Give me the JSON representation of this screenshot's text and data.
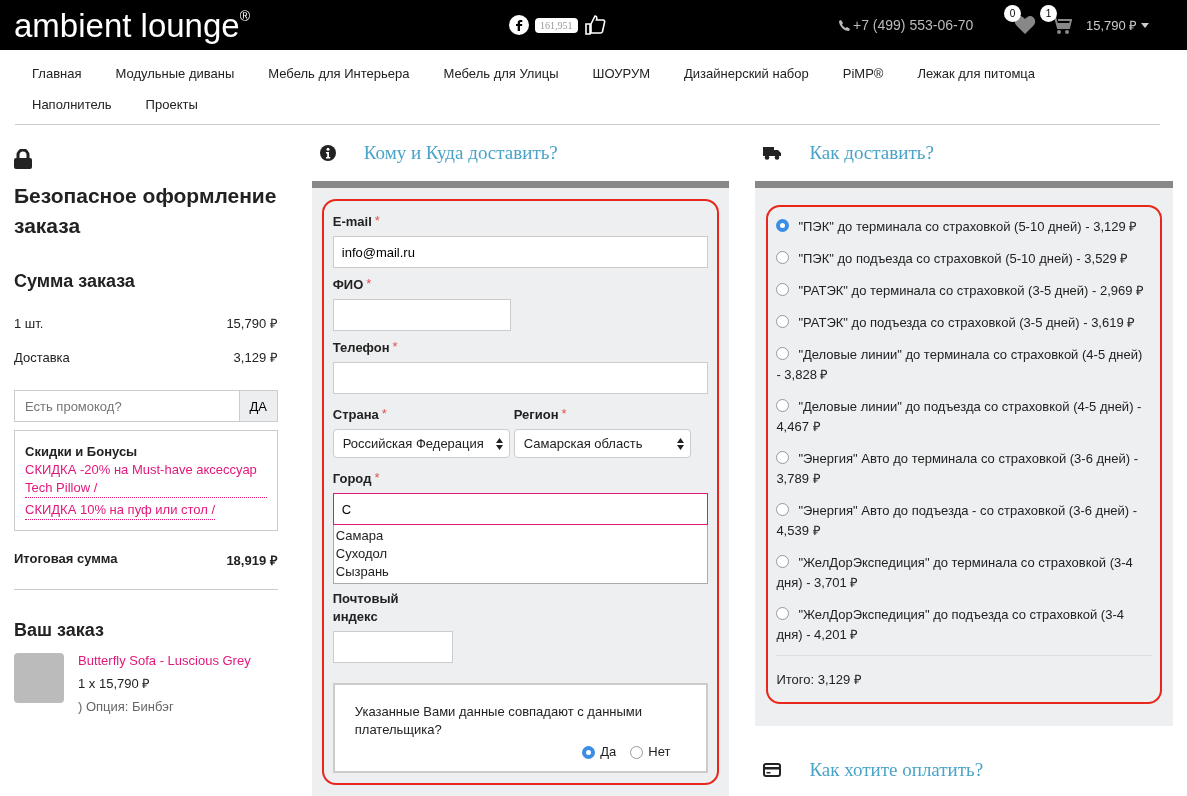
{
  "header": {
    "logo": "ambient lounge$^{®}$",
    "like_count": "161,951",
    "phone": "+7 (499) 553-06-70",
    "wishlist_count": "0",
    "cart_count": "1",
    "cart_total": "15,790 ₽"
  },
  "nav": [
    {
      "label": "Главная"
    },
    {
      "label": "Модульные диваны"
    },
    {
      "label": "Мебель для Интерьера"
    },
    {
      "label": "Мебель для Улицы"
    },
    {
      "label": "ШОУРУМ"
    },
    {
      "label": "Дизайнерский набор"
    },
    {
      "label": "PiMP®"
    },
    {
      "label": "Лежак для питомца"
    },
    {
      "label": "Наполнитель"
    },
    {
      "label": "Проекты"
    }
  ],
  "summary": {
    "title": "Безопасное оформление заказа",
    "sum_title": "Сумма заказа",
    "rows": [
      {
        "label": "1 шт.",
        "value": "15,790 ₽"
      },
      {
        "label": "Доставка",
        "value": "3,129 ₽"
      }
    ],
    "promo": {
      "placeholder": "Есть промокод?",
      "button": "ДА"
    },
    "bonus": {
      "title": "Скидки и Бонусы",
      "links": [
        "СКИДКА -20% на Must-have аксессуар Tech Pillow /",
        "СКИДКА 10% на пуф или стол /"
      ]
    },
    "total": {
      "label": "Итоговая сумма",
      "value": "18,919 ₽"
    },
    "order_title": "Ваш заказ",
    "item": {
      "name": "Butterfly Sofa - Luscious Grey",
      "qty": "1 x 15,790 ₽",
      "option": ") Опция: Бинбэг"
    }
  },
  "recipient": {
    "title": "Кому и Куда доставить?",
    "fields": [
      {
        "kind": "wide",
        "label": "E-mail",
        "marker": "*",
        "value": "info@mail.ru"
      },
      {
        "kind": "half",
        "label": "ФИО",
        "marker": "*"
      },
      {
        "kind": "wide",
        "label": "Телефон",
        "marker": "*"
      },
      {
        "kind": "selects",
        "items": [
          {
            "label": "Страна",
            "marker": "*",
            "value": "Российская Федерация"
          },
          {
            "label": "Регион",
            "marker": "*",
            "value": "Самарская область"
          }
        ]
      },
      {
        "kind": "autocomplete",
        "label": "Город",
        "marker": "*",
        "value": "С",
        "suggestions": [
          "Самара",
          "Суходол",
          "Сызрань"
        ]
      },
      {
        "kind": "narrow",
        "label": "Почтовый индекс"
      }
    ],
    "payer_question": "Указанные Вами данные совпадают с данными плательщика?",
    "payer_options": [
      {
        "label": "Да",
        "selected": true
      },
      {
        "label": "Нет",
        "selected": false
      }
    ]
  },
  "delivery": {
    "title": "Как доставить?",
    "options": [
      {
        "label": "\"ПЭК\" до терминала со страховкой (5-10 дней) - 3,129 ₽",
        "selected": true
      },
      {
        "label": "\"ПЭК\" до подъезда со страховкой (5-10 дней) - 3,529 ₽",
        "selected": false
      },
      {
        "label": "\"РАТЭК\" до терминала со страховкой (3-5 дней) - 2,969 ₽",
        "selected": false
      },
      {
        "label": "\"РАТЭК\" до подъезда со страховкой (3-5 дней) - 3,619 ₽",
        "selected": false
      },
      {
        "label": "\"Деловые линии\" до терминала со страховкой (4-5 дней) - 3,828 ₽",
        "selected": false
      },
      {
        "label": "\"Деловые линии\" до подъезда со страховкой (4-5 дней) - 4,467 ₽",
        "selected": false
      },
      {
        "label": "\"Энергия\" Авто до терминала со страховкой (3-6 дней) - 3,789 ₽",
        "selected": false
      },
      {
        "label": "\"Энергия\" Авто до подъезда - со страховкой (3-6 дней) - 4,539 ₽",
        "selected": false
      },
      {
        "label": "\"ЖелДорЭкспедиция\" до терминала со страховкой (3-4 дня) - 3,701 ₽",
        "selected": false
      },
      {
        "label": "\"ЖелДорЭкспедиция\" до подъезда со страховкой (3-4 дня) - 4,201 ₽",
        "selected": false
      }
    ],
    "total": "Итого: 3,129 ₽"
  },
  "payment": {
    "title": "Как хотите оплатить?"
  }
}
